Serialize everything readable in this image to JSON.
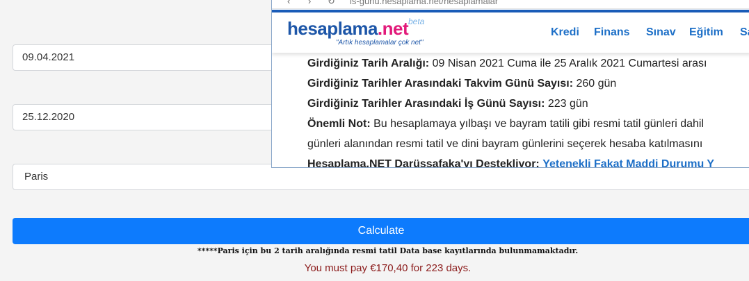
{
  "form": {
    "date1": "09.04.2021",
    "date2": "25.12.2020",
    "city": "Paris",
    "calculate_label": "Calculate",
    "note": "*****Paris için bu 2 tarih aralığında resmi tatil Data base kayıtlarında bulunmamaktadır.",
    "result": "You must pay €170,40 for 223 days."
  },
  "overlay": {
    "url": "is-gunu.hesaplama.net/hesaplamalar",
    "logo_part1": "hesaplama",
    "logo_part2": ".net",
    "logo_beta": "beta",
    "logo_slogan": "\"Artık hesaplamalar çok net\"",
    "menu": [
      "Kredi",
      "Finans",
      "Sınav",
      "Eğitim",
      "Sa"
    ],
    "lines": [
      {
        "label": "Girdiğiniz Tarih Aralığı:",
        "text": " 09 Nisan 2021 Cuma ile 25 Aralık 2021 Cumartesi arası"
      },
      {
        "label": "Girdiğiniz Tarihler Arasındaki Takvim Günü Sayısı:",
        "text": " 260 gün"
      },
      {
        "label": "Girdiğiniz Tarihler Arasındaki İş Günü Sayısı:",
        "text": " 223 gün"
      },
      {
        "label": "Önemli Not:",
        "text": " Bu hesaplamaya yılbaşı ve bayram tatili gibi resmi tatil günleri dahil"
      },
      {
        "label": "",
        "text": "günleri alanından resmi tatil ve dini bayram günlerini seçerek hesaba katılmasını"
      }
    ],
    "last_line_label": "Hesaplama.NET Darüşşafaka'yı Destekliyor:",
    "last_line_link": "Yetenekli Fakat Maddi Durumu Y"
  },
  "colors": {
    "accent": "#0d7bfd",
    "result_text": "#8b1a1a",
    "logo_blue": "#1d56a8",
    "logo_pink": "#e2197a"
  }
}
